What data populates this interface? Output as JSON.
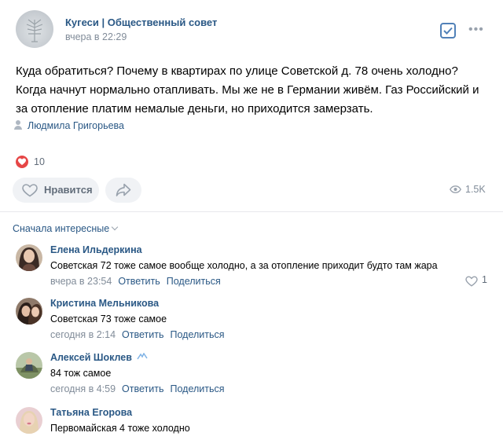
{
  "post": {
    "group_name": "Кугеси | Общественный совет",
    "time": "вчера в 22:29",
    "text_lines": [
      "Куда обратиться? Почему в квартирах по улице Советской д. 78 очень холодно?",
      "Когда начнут нормально отапливать. Мы же не в Германии живём. Газ Российский и",
      "за отопление платим немалые деньги, но приходится замерзать."
    ],
    "author": "Людмила Григорьева",
    "reactions_count": "10",
    "like_label": "Нравится",
    "views": "1.5K"
  },
  "comments_section": {
    "sort_label": "Сначала интересные"
  },
  "comments": [
    {
      "name": "Елена Ильдеркина",
      "text": "Советская 72 тоже самое вообще холодно, а за отопление приходит будто там жара",
      "time": "вчера в 23:54",
      "reply": "Ответить",
      "share": "Поделиться",
      "likes": "1"
    },
    {
      "name": "Кристина Мельникова",
      "text": "Советская 73 тоже самое",
      "time": "сегодня в 2:14",
      "reply": "Ответить",
      "share": "Поделиться"
    },
    {
      "name": "Алексей Шоклев",
      "text": "84 тож самое",
      "time": "сегодня в 4:59",
      "reply": "Ответить",
      "share": "Поделиться"
    },
    {
      "name": "Татьяна Егорова",
      "text": "Первомайская 4 тоже холодно"
    }
  ],
  "icons": {
    "check": "checkbox-icon",
    "more": "more-dots-icon",
    "heart": "heart-icon",
    "share": "share-arrow-icon",
    "views": "eye-icon",
    "user": "user-icon"
  },
  "colors": {
    "link": "#2a5885",
    "muted": "#818c99",
    "accent": "#5181b8",
    "heart": "#e64646",
    "button_bg": "#f0f2f5"
  }
}
